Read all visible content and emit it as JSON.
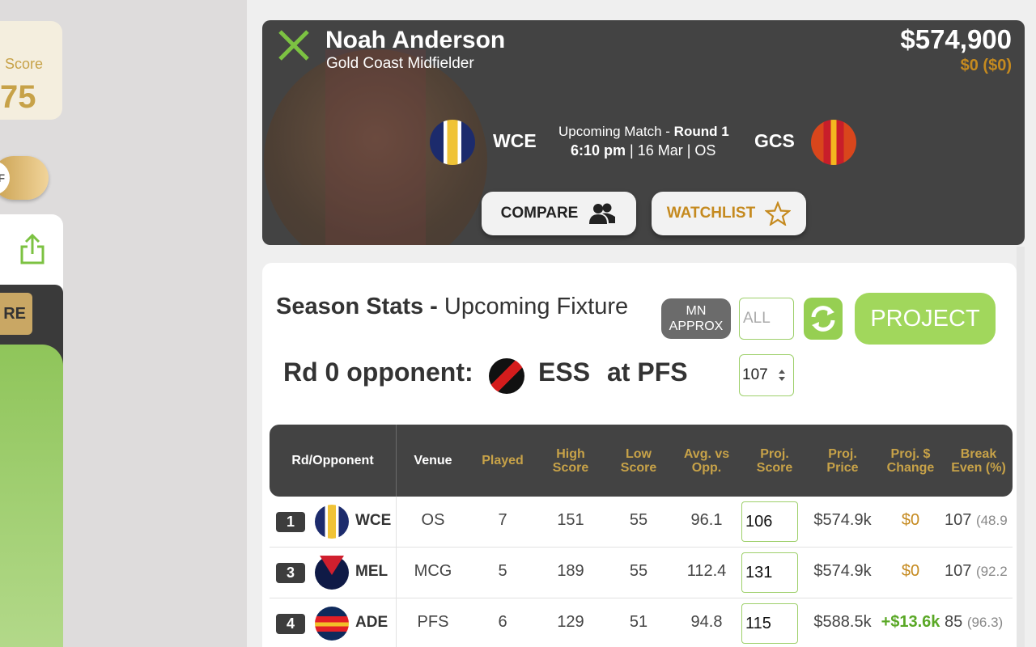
{
  "left": {
    "score_label": "Score",
    "score_value": "75",
    "toggle_text": "FF",
    "re_button": "RE"
  },
  "player": {
    "name": "Noah Anderson",
    "subtitle": "Gold Coast Midfielder",
    "price": "$574,900",
    "price_change": "$0  ($0)",
    "home_team": "WCE",
    "away_team": "GCS",
    "match_label": "Upcoming Match - ",
    "match_round": "Round 1",
    "match_time": "6:10 pm",
    "match_rest": " | 16 Mar | OS",
    "compare_label": "COMPARE",
    "watchlist_label": "WATCHLIST"
  },
  "stats": {
    "title_bold": "Season Stats - ",
    "title_rest": "Upcoming Fixture",
    "mn_label_1": "MN",
    "mn_label_2": "APPROX",
    "filter_placeholder": "ALL",
    "project_label": "PROJECT",
    "opponent_line": "Rd 0 opponent:",
    "opponent_code": "ESS",
    "opponent_venue": "at PFS",
    "opponent_value": "107"
  },
  "table": {
    "headers": {
      "rd": "Rd/Opponent",
      "venue": "Venue",
      "played": "Played",
      "high_1": "High",
      "high_2": "Score",
      "low_1": "Low",
      "low_2": "Score",
      "avg_1": "Avg. vs",
      "avg_2": "Opp.",
      "proj_1": "Proj.",
      "proj_2": "Score",
      "price_1": "Proj.",
      "price_2": "Price",
      "change_1": "Proj. $",
      "change_2": "Change",
      "be_1": "Break",
      "be_2": "Even (%)"
    },
    "rows": [
      {
        "rd": "1",
        "team": "WCE",
        "venue": "OS",
        "played": "7",
        "high": "151",
        "low": "55",
        "avg": "96.1",
        "proj": "106",
        "price": "$574.9k",
        "change": "$0",
        "be": "107",
        "be_pct": "(48.9"
      },
      {
        "rd": "3",
        "team": "MEL",
        "venue": "MCG",
        "played": "5",
        "high": "189",
        "low": "55",
        "avg": "112.4",
        "proj": "131",
        "price": "$574.9k",
        "change": "$0",
        "be": "107",
        "be_pct": "(92.2"
      },
      {
        "rd": "4",
        "team": "ADE",
        "venue": "PFS",
        "played": "6",
        "high": "129",
        "low": "51",
        "avg": "94.8",
        "proj": "115",
        "price": "$588.5k",
        "change": "+$13.6k",
        "be": "85",
        "be_pct": "(96.3)"
      }
    ]
  },
  "colors": {
    "accent_green": "#96cf52",
    "gold": "#c58a1f",
    "dark_card": "#434343"
  }
}
